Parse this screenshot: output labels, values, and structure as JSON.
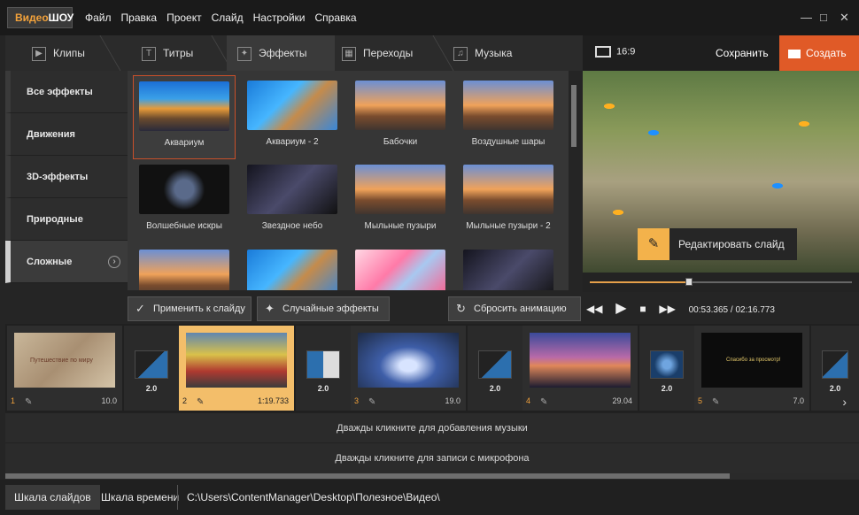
{
  "app": {
    "logo_part1": "Видео",
    "logo_part2": "ШОУ",
    "menu": [
      "Файл",
      "Правка",
      "Проект",
      "Слайд",
      "Настройки",
      "Справка"
    ]
  },
  "tabs": [
    {
      "label": "Клипы",
      "icon": "play-icon"
    },
    {
      "label": "Титры",
      "icon": "text-icon"
    },
    {
      "label": "Эффекты",
      "icon": "magic-wand-icon"
    },
    {
      "label": "Переходы",
      "icon": "clapper-icon"
    },
    {
      "label": "Музыка",
      "icon": "music-icon"
    }
  ],
  "preview_header": {
    "aspect": "16:9",
    "save_label": "Сохранить",
    "create_label": "Создать"
  },
  "categories": [
    {
      "label": "Все эффекты"
    },
    {
      "label": "Движения"
    },
    {
      "label": "3D-эффекты"
    },
    {
      "label": "Природные"
    },
    {
      "label": "Сложные",
      "active": true
    }
  ],
  "effects": [
    {
      "label": "Аквариум",
      "selected": true
    },
    {
      "label": "Аквариум - 2"
    },
    {
      "label": "Бабочки"
    },
    {
      "label": "Воздушные шары"
    },
    {
      "label": "Волшебные искры"
    },
    {
      "label": "Звездное небо"
    },
    {
      "label": "Мыльные пузыри"
    },
    {
      "label": "Мыльные пузыри - 2"
    },
    {
      "label": ""
    },
    {
      "label": ""
    },
    {
      "label": ""
    },
    {
      "label": ""
    }
  ],
  "preview": {
    "edit_slide_label": "Редактировать слайд",
    "seek_progress": 0.38
  },
  "actions": {
    "apply_label": "Применить к слайду",
    "random_label": "Случайные эффекты",
    "reset_label": "Сбросить анимацию"
  },
  "player": {
    "time": "00:53.365 / 02:16.773"
  },
  "timeline": {
    "slides": [
      {
        "num": "1",
        "duration": "10.0",
        "caption": "Путешествие по миру"
      },
      {
        "num": "2",
        "duration": "1:19.733",
        "active": true
      },
      {
        "num": "3",
        "duration": "19.0"
      },
      {
        "num": "4",
        "duration": "29.04"
      },
      {
        "num": "5",
        "duration": "7.0",
        "caption": "Спасибо за просмотр!"
      }
    ],
    "transitions": [
      "2.0",
      "2.0",
      "2.0",
      "2.0",
      "2.0"
    ]
  },
  "tracks": {
    "music_hint": "Дважды кликните для добавления музыки",
    "mic_hint": "Дважды кликните для записи с микрофона"
  },
  "bottom": {
    "tab_slides": "Шкала слайдов",
    "tab_time": "Шкала времени",
    "path": "C:\\Users\\ContentManager\\Desktop\\Полезное\\Видео\\"
  }
}
